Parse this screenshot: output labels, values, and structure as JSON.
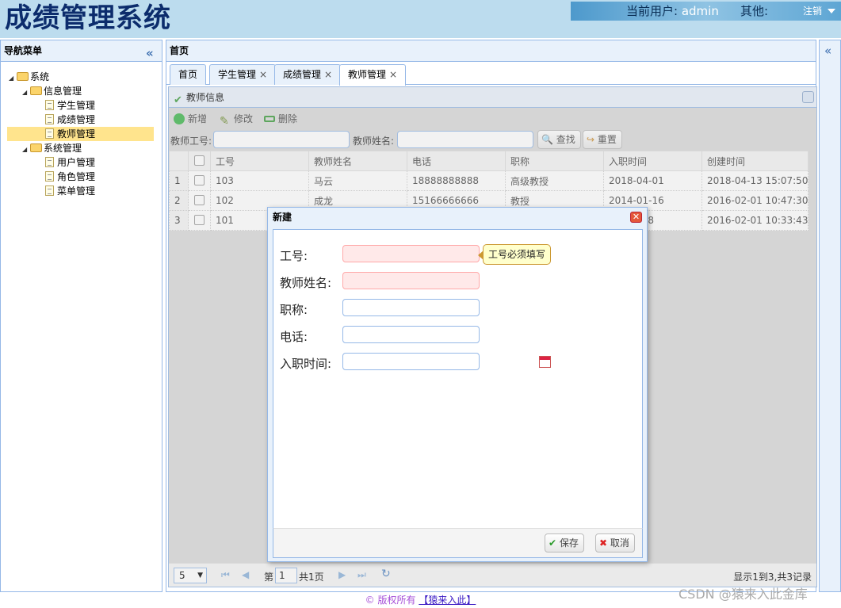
{
  "app": {
    "title": "成绩管理系统"
  },
  "userbar": {
    "current_user_label": "当前用户:",
    "username": "admin",
    "other_label": "其他:",
    "logout": "注销"
  },
  "nav": {
    "title": "导航菜单",
    "collapse_icon": "«",
    "tree": {
      "root": "系统",
      "info_group": "信息管理",
      "info_items": [
        "学生管理",
        "成绩管理",
        "教师管理"
      ],
      "system_group": "系统管理",
      "system_items": [
        "用户管理",
        "角色管理",
        "菜单管理"
      ],
      "selected": "教师管理"
    }
  },
  "center": {
    "title": "首页",
    "tabs": [
      {
        "label": "首页",
        "closable": false
      },
      {
        "label": "学生管理",
        "closable": true
      },
      {
        "label": "成绩管理",
        "closable": true
      },
      {
        "label": "教师管理",
        "closable": true,
        "active": true
      }
    ],
    "close_glyph": "×"
  },
  "grid": {
    "title": "教师信息",
    "toolbar": {
      "add": "新增",
      "edit": "修改",
      "delete": "删除"
    },
    "search": {
      "id_label": "教师工号:",
      "name_label": "教师姓名:",
      "find_button": "查找",
      "reset_button": "重置"
    },
    "columns": [
      "工号",
      "教师姓名",
      "电话",
      "职称",
      "入职时间",
      "创建时间"
    ],
    "rows": [
      {
        "n": "1",
        "id": "103",
        "name": "马云",
        "phone": "18888888888",
        "title": "高级教授",
        "hired": "2018-04-01",
        "created": "2018-04-13 15:07:50"
      },
      {
        "n": "2",
        "id": "102",
        "name": "成龙",
        "phone": "15166666666",
        "title": "教授",
        "hired": "2014-01-16",
        "created": "2016-02-01 10:47:30"
      },
      {
        "n": "3",
        "id": "101",
        "name": "",
        "phone": "",
        "title": "",
        "hired": "18",
        "created": "2016-02-01 10:33:43"
      }
    ],
    "pager": {
      "page_size": "5",
      "page_prefix": "第",
      "page_value": "1",
      "page_suffix": "共1页",
      "summary": "显示1到3,共3记录"
    }
  },
  "dialog": {
    "title": "新建",
    "fields": {
      "id": "工号:",
      "name": "教师姓名:",
      "title": "职称:",
      "phone": "电话:",
      "hired": "入职时间:"
    },
    "tooltip": "工号必须填写",
    "save": "保存",
    "cancel": "取消"
  },
  "footer": {
    "copyright": "© 版权所有",
    "link": "【猿来入此】"
  },
  "watermark": "CSDN @猿来入此金库",
  "colors": {
    "accent_border": "#95b8e7",
    "panel_header": "#e8f1fb",
    "selected_row": "#ffe48d",
    "error_field": "#ffe9e9"
  }
}
